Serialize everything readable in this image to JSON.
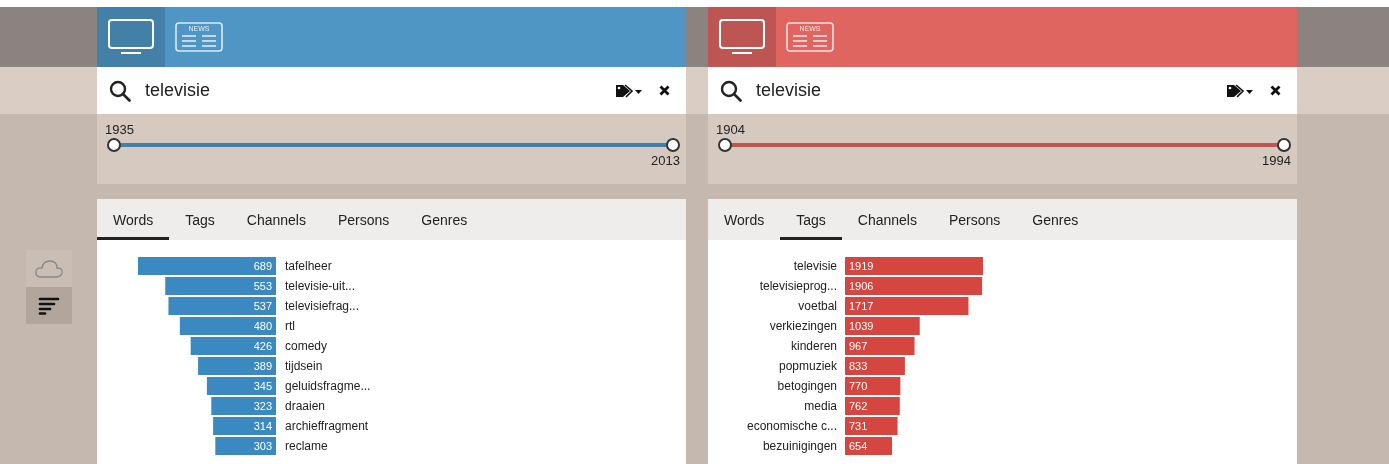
{
  "view_toggle": [
    {
      "kind": "cloud",
      "selected": false
    },
    {
      "kind": "bars",
      "selected": true
    }
  ],
  "panels": [
    {
      "color": "#4f96c4",
      "bars_mirrored": true,
      "sources": [
        {
          "kind": "tv",
          "selected": true
        },
        {
          "kind": "news",
          "selected": false,
          "label": "NEWS"
        }
      ],
      "search": {
        "value": "televisie"
      },
      "slider": {
        "thumbs": [
          {
            "label": "1935",
            "level": 0
          },
          {
            "label": "2013",
            "level": 1
          }
        ]
      },
      "tabs": [
        {
          "label": "Words",
          "selected": true
        },
        {
          "label": "Tags",
          "selected": false
        },
        {
          "label": "Channels",
          "selected": false
        },
        {
          "label": "Persons",
          "selected": false
        },
        {
          "label": "Genres",
          "selected": false
        }
      ],
      "chart_data": {
        "type": "bar",
        "orientation": "horizontal",
        "data_labels": true,
        "categories": [
          "tafelheer",
          "televisie-uit...",
          "televisiefrag...",
          "rtl",
          "comedy",
          "tijdsein",
          "geluidsfragme...",
          "draaien",
          "archieffragment",
          "reclame"
        ],
        "series": [
          {
            "color": "#3a89c0",
            "values": [
              689,
              553,
              537,
              480,
              426,
              389,
              345,
              323,
              314,
              303
            ]
          }
        ]
      }
    },
    {
      "color": "#de6560",
      "bars_mirrored": false,
      "sources": [
        {
          "kind": "tv",
          "selected": true
        },
        {
          "kind": "news",
          "selected": false,
          "label": "NEWS"
        }
      ],
      "search": {
        "value": "televisie"
      },
      "slider": {
        "thumbs": [
          {
            "label": "1904",
            "level": 0
          },
          {
            "label": "1994",
            "level": 1
          }
        ]
      },
      "tabs": [
        {
          "label": "Words",
          "selected": false
        },
        {
          "label": "Tags",
          "selected": true
        },
        {
          "label": "Channels",
          "selected": false
        },
        {
          "label": "Persons",
          "selected": false
        },
        {
          "label": "Genres",
          "selected": false
        }
      ],
      "chart_data": {
        "type": "bar",
        "orientation": "horizontal",
        "data_labels": true,
        "categories": [
          "televisie",
          "televisieprog...",
          "voetbal",
          "verkiezingen",
          "kinderen",
          "popmuziek",
          "betogingen",
          "media",
          "economische c...",
          "bezuinigingen"
        ],
        "series": [
          {
            "color": "#d4463f",
            "values": [
              1919,
              1906,
              1717,
              1039,
              967,
              833,
              770,
              762,
              731,
              654
            ]
          }
        ]
      }
    }
  ]
}
